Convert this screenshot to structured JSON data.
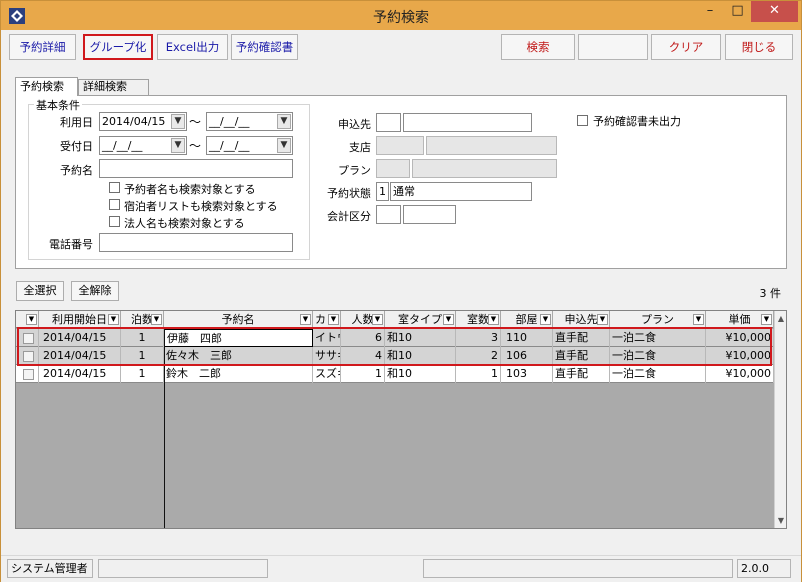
{
  "window": {
    "title": "予約検索",
    "min_glyph": "–",
    "max_glyph": "□",
    "close_glyph": "✕"
  },
  "toolbar": {
    "detail": "予約詳細",
    "group": "グループ化",
    "excel": "Excel出力",
    "confirm": "予約確認書",
    "search": "検索",
    "clear": "クリア",
    "close": "閉じる"
  },
  "tabs": {
    "search": "予約検索",
    "detail": "詳細検索"
  },
  "basic": {
    "legend": "基本条件",
    "use_date_label": "利用日",
    "use_date_from": "2014/04/15",
    "use_date_to": "__/__/__",
    "recv_date_label": "受付日",
    "recv_date_from": "__/__/__",
    "recv_date_to": "__/__/__",
    "tilde": "～",
    "name_label": "予約名",
    "name_value": "",
    "opt1": "予約者名も検索対象とする",
    "opt2": "宿泊者リストも検索対象とする",
    "opt3": "法人名も検索対象とする",
    "phone_label": "電話番号",
    "phone_value": ""
  },
  "right": {
    "applicant_label": "申込先",
    "branch_label": "支店",
    "plan_label": "プラン",
    "status_label": "予約状態",
    "status_code": "1",
    "status_value": "通常",
    "account_label": "会計区分",
    "unprinted_label": "予約確認書未出力"
  },
  "select_all": "全選択",
  "deselect_all": "全解除",
  "count": "3 件",
  "grid": {
    "columns": [
      "利用開始日",
      "泊数",
      "予約名",
      "カ",
      "人数",
      "室タイプ",
      "室数",
      "部屋",
      "申込先",
      "プラン",
      "単価"
    ],
    "rows": [
      {
        "date": "2014/04/15",
        "nights": "1",
        "name": "伊藤　四郎",
        "kana": "イトウ",
        "people": "6",
        "room_type": "和10",
        "rooms": "3",
        "room": "110",
        "applicant": "直手配",
        "plan": "一泊二食",
        "price": "¥10,000"
      },
      {
        "date": "2014/04/15",
        "nights": "1",
        "name": "佐々木　三郎",
        "kana": "ササキ",
        "people": "4",
        "room_type": "和10",
        "rooms": "2",
        "room": "106",
        "applicant": "直手配",
        "plan": "一泊二食",
        "price": "¥10,000"
      },
      {
        "date": "2014/04/15",
        "nights": "1",
        "name": "鈴木　二郎",
        "kana": "スズキ",
        "people": "1",
        "room_type": "和10",
        "rooms": "1",
        "room": "103",
        "applicant": "直手配",
        "plan": "一泊二食",
        "price": "¥10,000"
      }
    ]
  },
  "status": {
    "user": "システム管理者",
    "version": "2.0.0"
  },
  "colors": {
    "titlebar": "#e8a84a",
    "highlight": "#d0181c"
  }
}
